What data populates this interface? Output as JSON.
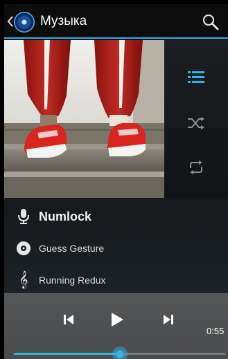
{
  "app": {
    "title": "Музыка",
    "icons": {
      "back": "chevron-left-icon",
      "app": "music-app-icon",
      "search": "search-icon"
    }
  },
  "album_art": {
    "description_icon": "album-cover-image"
  },
  "side_controls": [
    {
      "name": "now-playing-list-icon",
      "active": true
    },
    {
      "name": "shuffle-icon",
      "active": false
    },
    {
      "name": "repeat-icon",
      "active": false
    }
  ],
  "track": {
    "artist": "Numlock",
    "album": "Guess Gesture",
    "song": "Running Redux"
  },
  "transport": {
    "time": "0:55",
    "progress_fraction": 0.5
  },
  "colors": {
    "accent": "#33b5e5",
    "actionbar": "#0d0d0d",
    "transport_bg": "#4e4f50"
  }
}
